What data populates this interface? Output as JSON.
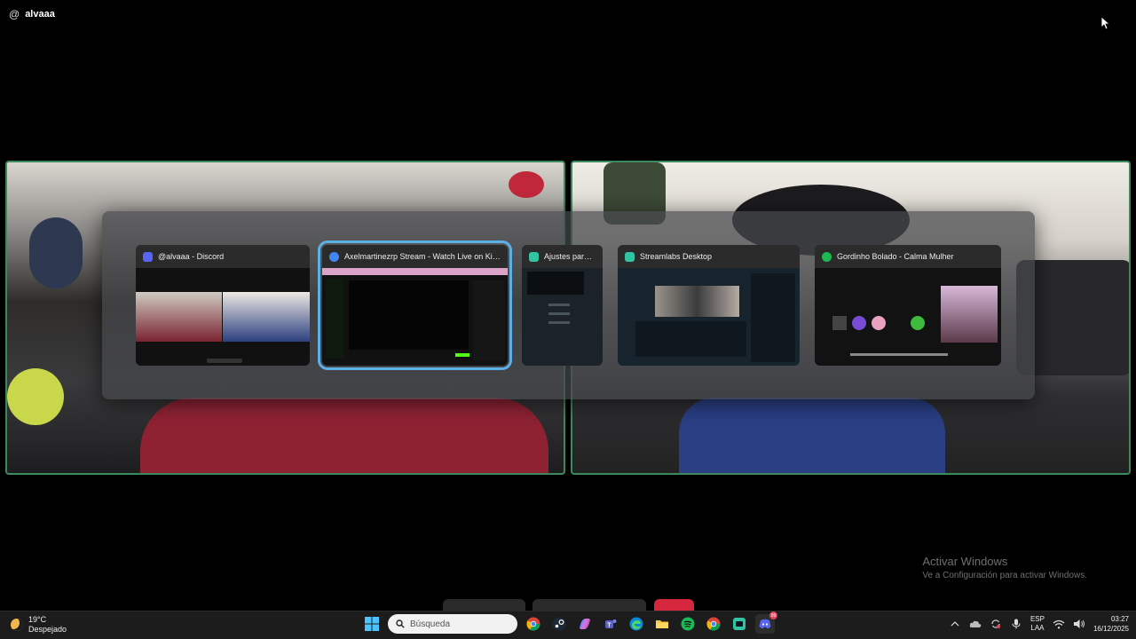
{
  "header": {
    "at_symbol": "@",
    "username": "alvaaa"
  },
  "task_switcher": {
    "windows": [
      {
        "title": "@alvaaa - Discord",
        "icon": "discord-icon",
        "icon_color": "#5865F2"
      },
      {
        "title": "Axelmartinezrp Stream - Watch Live on Kick -...",
        "icon": "chrome-icon",
        "icon_color": "#4285F4",
        "selected": true
      },
      {
        "title": "Ajustes para C...",
        "icon": "streamlabs-icon",
        "icon_color": "#31c3a2"
      },
      {
        "title": "Streamlabs Desktop",
        "icon": "streamlabs-icon",
        "icon_color": "#31c3a2"
      },
      {
        "title": "Gordinho Bolado - Calma Mulher",
        "icon": "spotify-icon",
        "icon_color": "#1DB954"
      }
    ]
  },
  "watermark": {
    "title": "Activar Windows",
    "subtitle": "Ve a Configuración para activar Windows."
  },
  "taskbar": {
    "weather": {
      "temp": "19°C",
      "condition": "Despejado"
    },
    "search_placeholder": "Búsqueda",
    "apps": [
      "start-icon",
      "search",
      "chrome-icon",
      "steam-icon",
      "copilot-icon",
      "teams-icon",
      "edge-icon",
      "file-explorer-icon",
      "spotify-icon",
      "chrome-alt-icon",
      "streamlabs-icon",
      "discord-icon"
    ],
    "discord_badge": "99",
    "tray": {
      "lang_line1": "ESP",
      "lang_line2": "LAA",
      "time": "03:27",
      "date": "16/12/2025"
    }
  }
}
